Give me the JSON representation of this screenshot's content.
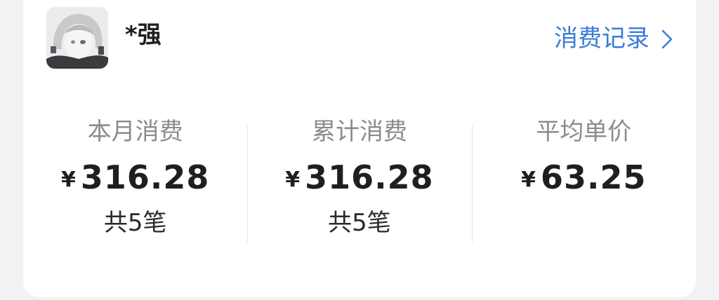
{
  "user": {
    "name": "*强",
    "avatar_icon": "anime-avatar-icon"
  },
  "header": {
    "record_link_label": "消费记录",
    "record_link_icon": "chevron-right-icon",
    "accent_color": "#3a7bd8"
  },
  "stats": [
    {
      "label": "本月消费",
      "currency": "¥",
      "value": "316.28",
      "count": "共5笔"
    },
    {
      "label": "累计消费",
      "currency": "¥",
      "value": "316.28",
      "count": "共5笔"
    },
    {
      "label": "平均单价",
      "currency": "¥",
      "value": "63.25",
      "count": ""
    }
  ]
}
